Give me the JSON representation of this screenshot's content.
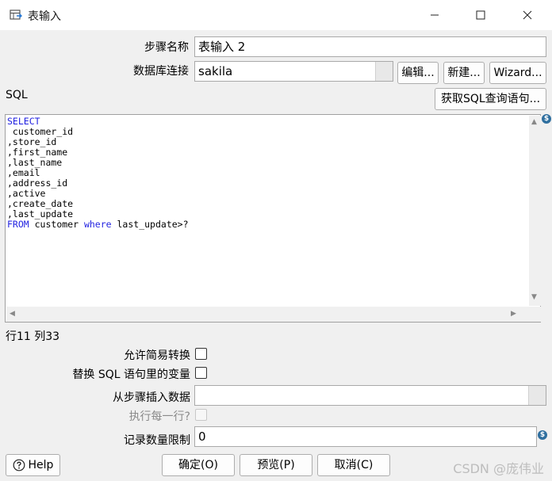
{
  "window": {
    "title": "表输入",
    "app_icon": "table-input-icon"
  },
  "form": {
    "step_name_label": "步骤名称",
    "step_name_value": "表输入 2",
    "db_conn_label": "数据库连接",
    "db_conn_value": "sakila",
    "edit_button": "编辑...",
    "new_button": "新建...",
    "wizard_button": "Wizard...",
    "sql_label": "SQL",
    "get_sql_button": "获取SQL查询语句..."
  },
  "sql": {
    "lines": [
      "SELECT",
      " customer_id",
      ",store_id",
      ",first_name",
      ",last_name",
      ",email",
      ",address_id",
      ",active",
      ",create_date",
      ",last_update",
      "FROM customer where last_update>?"
    ],
    "position": "行11 列33"
  },
  "options": {
    "lazy_conversion_label": "允许简易转换",
    "replace_vars_label": "替换 SQL 语句里的变量",
    "insert_from_step_label": "从步骤插入数据",
    "insert_from_step_value": "",
    "execute_each_row_label": "执行每一行?",
    "limit_label": "记录数量限制",
    "limit_value": "0"
  },
  "footer": {
    "help_button": "Help",
    "ok_button": "确定(O)",
    "preview_button": "预览(P)",
    "cancel_button": "取消(C)",
    "watermark": "CSDN @庞伟业"
  },
  "colors": {
    "keyword": "#1f1fe0",
    "variable_badge": "#2f6f9f"
  }
}
